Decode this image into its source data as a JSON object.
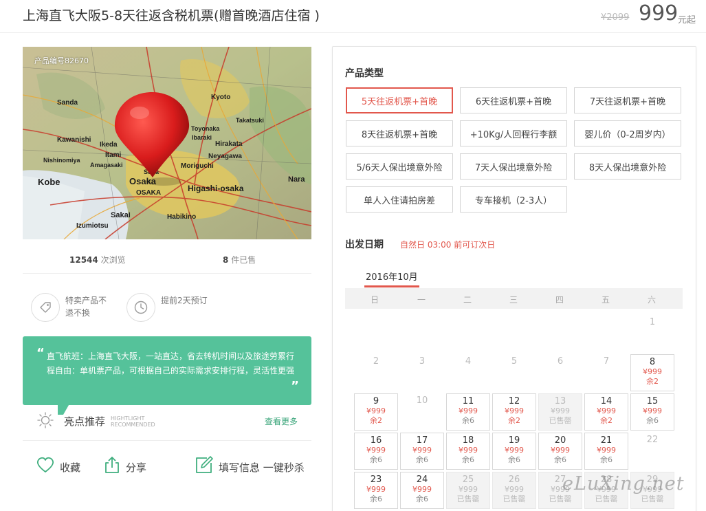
{
  "header": {
    "title": "上海直飞大阪5-8天往返含税机票(赠首晚酒店住宿 )",
    "old_price": "¥2099",
    "price": "999",
    "price_unit": "元起"
  },
  "product": {
    "number_label": "产品编号82670",
    "views_count": "12544",
    "views_label": "次浏览",
    "sold_count": "8",
    "sold_label": "件已售"
  },
  "features": [
    {
      "icon": "tag-icon",
      "text": "特卖产品不退不换"
    },
    {
      "icon": "clock-icon",
      "text": "提前2天预订"
    }
  ],
  "intro": {
    "text": "直飞航班：上海直飞大阪，一站直达，省去转机时间以及旅途劳累行程自由：单机票产品，可根据自己的实际需求安排行程，灵活性更强",
    "quote_open": "“",
    "quote_close": "”"
  },
  "highlight": {
    "label": "亮点推荐",
    "en_1": "HIGHTLIGHT",
    "en_2": "RECOMMENDED",
    "more": "查看更多"
  },
  "actions": {
    "favorite": "收藏",
    "share": "分享",
    "fill_info": "填写信息 一键秒杀"
  },
  "product_types": {
    "title": "产品类型",
    "items": [
      "5天往返机票+首晚",
      "6天往返机票+首晚",
      "7天往返机票+首晚",
      "8天往返机票+首晚",
      "+10Kg/人回程行李额",
      "婴儿价（0-2周岁内）",
      "5/6天人保出境意外险",
      "7天人保出境意外险",
      "8天人保出境意外险",
      "单人入住请拍房差",
      "专车接机（2-3人）"
    ],
    "selected": "5天往返机票+首晚"
  },
  "departure": {
    "title": "出发日期",
    "note": "自然日 03:00 前可订次日",
    "month": "2016年10月",
    "weekdays": [
      "日",
      "一",
      "二",
      "三",
      "四",
      "五",
      "六"
    ],
    "days": [
      {
        "d": "1",
        "status": "plain"
      },
      {
        "d": "2",
        "status": "plain"
      },
      {
        "d": "3",
        "status": "plain"
      },
      {
        "d": "4",
        "status": "plain"
      },
      {
        "d": "5",
        "status": "plain"
      },
      {
        "d": "6",
        "status": "plain"
      },
      {
        "d": "7",
        "status": "plain"
      },
      {
        "d": "8",
        "status": "avail",
        "price": "¥999",
        "stock": "余2"
      },
      {
        "d": "9",
        "status": "avail",
        "price": "¥999",
        "stock": "余2"
      },
      {
        "d": "10",
        "status": "plain"
      },
      {
        "d": "11",
        "status": "avail",
        "price": "¥999",
        "stock": "余6"
      },
      {
        "d": "12",
        "status": "avail",
        "price": "¥999",
        "stock": "余2"
      },
      {
        "d": "13",
        "status": "soldout",
        "price": "¥999",
        "stock": "已售罄"
      },
      {
        "d": "14",
        "status": "avail",
        "price": "¥999",
        "stock": "余2"
      },
      {
        "d": "15",
        "status": "avail",
        "price": "¥999",
        "stock": "余6"
      },
      {
        "d": "16",
        "status": "avail",
        "price": "¥999",
        "stock": "余6"
      },
      {
        "d": "17",
        "status": "avail",
        "price": "¥999",
        "stock": "余6"
      },
      {
        "d": "18",
        "status": "avail",
        "price": "¥999",
        "stock": "余6"
      },
      {
        "d": "19",
        "status": "avail",
        "price": "¥999",
        "stock": "余6"
      },
      {
        "d": "20",
        "status": "avail",
        "price": "¥999",
        "stock": "余6"
      },
      {
        "d": "21",
        "status": "avail",
        "price": "¥999",
        "stock": "余6"
      },
      {
        "d": "22",
        "status": "plain"
      },
      {
        "d": "23",
        "status": "avail",
        "price": "¥999",
        "stock": "余6"
      },
      {
        "d": "24",
        "status": "avail",
        "price": "¥999",
        "stock": "余6"
      },
      {
        "d": "25",
        "status": "soldout",
        "price": "¥999",
        "stock": "已售罄"
      },
      {
        "d": "26",
        "status": "soldout",
        "price": "¥999",
        "stock": "已售罄"
      },
      {
        "d": "27",
        "status": "soldout",
        "price": "¥999",
        "stock": "已售罄"
      },
      {
        "d": "28",
        "status": "soldout",
        "price": "¥999",
        "stock": "已售罄"
      },
      {
        "d": "29",
        "status": "soldout",
        "price": "¥999",
        "stock": "已售罄"
      }
    ]
  },
  "map_labels": [
    "Kyoto",
    "Kobe",
    "Osaka",
    "OSAKA",
    "Higashi-osaka",
    "Moriguchi",
    "Hirakata",
    "Neyagawa",
    "Nara",
    "Sakai",
    "Izumiotsu",
    "Habikino",
    "Kawanishi",
    "Ikeda",
    "Sanda",
    "Itami",
    "Amagasaki",
    "Nishinomiya",
    "Toyonaka",
    "Suita",
    "Ibaraki",
    "Takatsuki"
  ],
  "watermark": "eLuXing.net",
  "colors": {
    "accent": "#e2574c",
    "green": "#55c29a"
  }
}
